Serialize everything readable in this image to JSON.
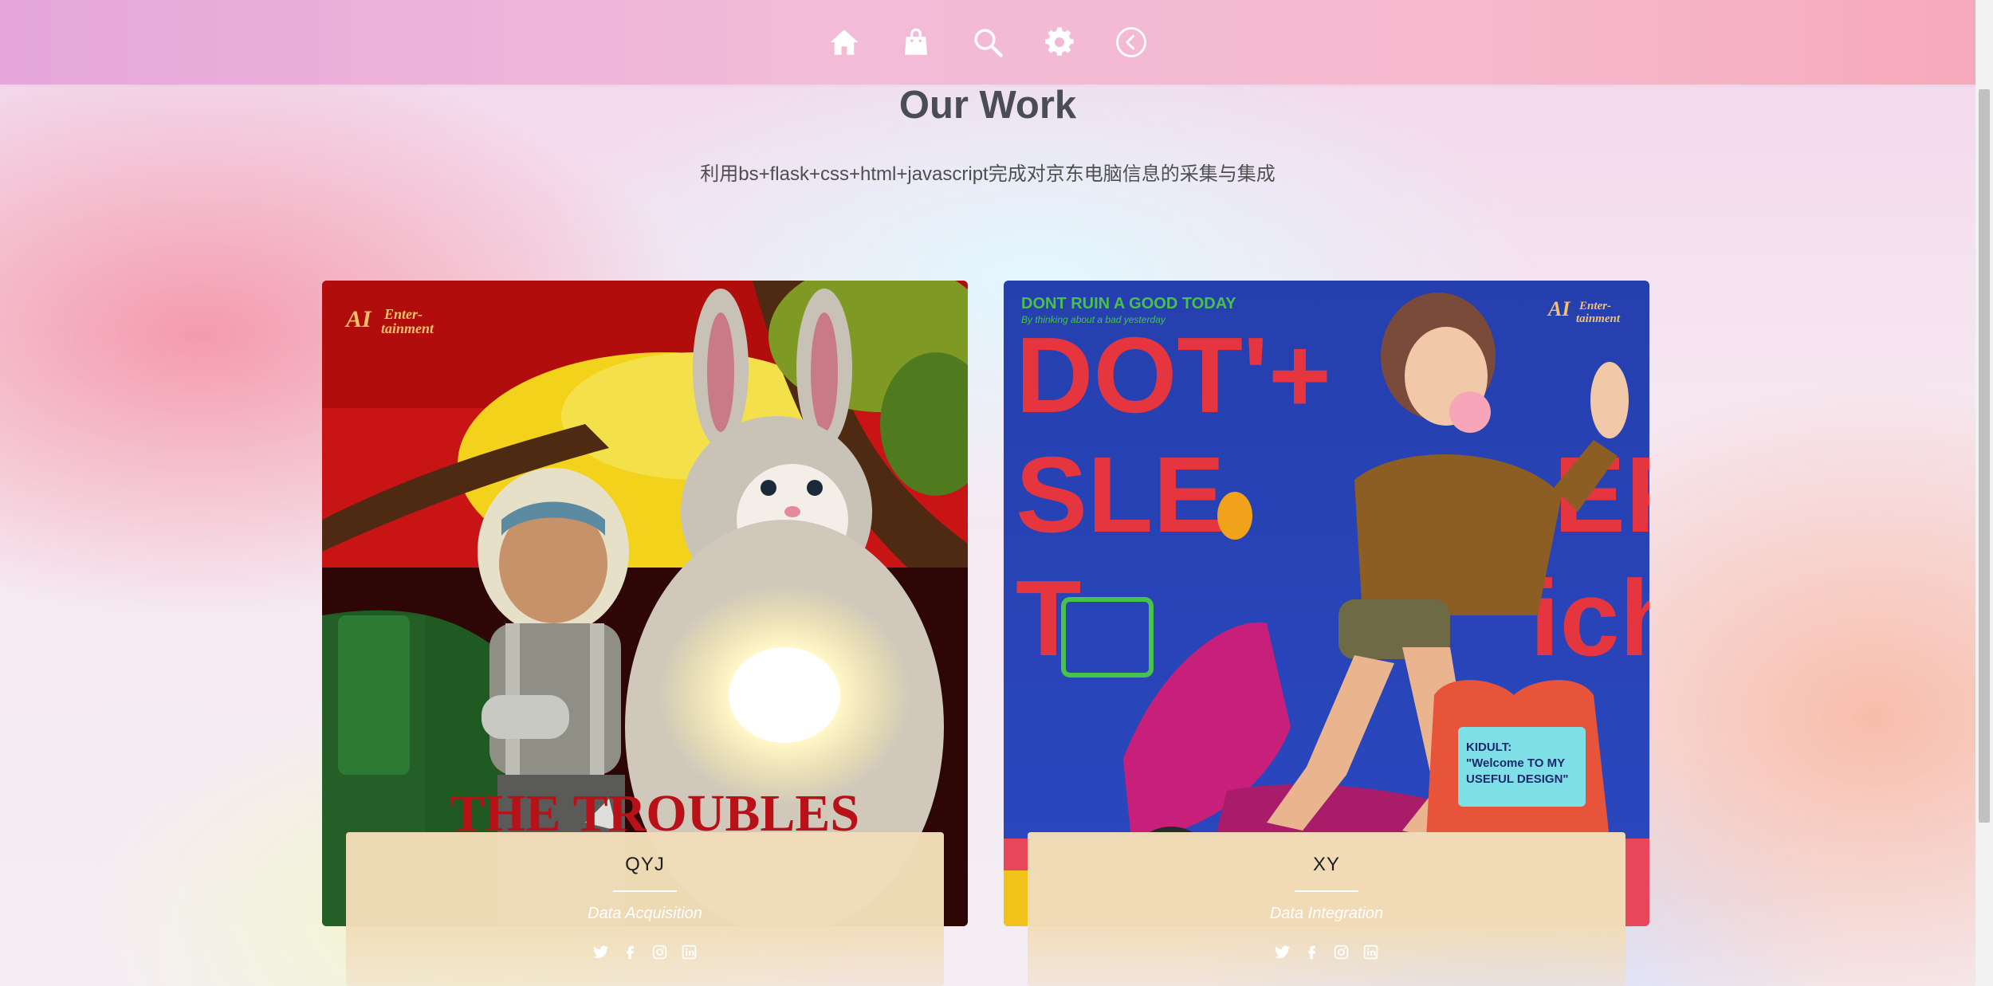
{
  "nav": {
    "items": [
      {
        "name": "home-icon"
      },
      {
        "name": "shopping-bag-icon"
      },
      {
        "name": "search-icon"
      },
      {
        "name": "gear-icon"
      },
      {
        "name": "back-circle-icon"
      }
    ]
  },
  "section": {
    "title": "Our Work",
    "subtitle": "利用bs+flask+css+html+javascript完成对京东电脑信息的采集与集成"
  },
  "team": [
    {
      "name": "QYJ",
      "role": "Data Acquisition",
      "image_text": "THE TROUBLES",
      "brand": "AI Enter-tainment"
    },
    {
      "name": "XY",
      "role": "Data Integration",
      "image_text": "DONT RUIN A GOOD TODAY",
      "brand": "AI Enter-tainment",
      "screen_text": "KIDULT: \"Welcome TO MY USEFUL DESIGN\""
    }
  ],
  "socials": [
    "twitter-icon",
    "facebook-icon",
    "instagram-icon",
    "linkedin-icon"
  ],
  "colors": {
    "nav_start": "#e6a6da",
    "nav_end": "#f7a9bb",
    "card_info": "#f1ddb8",
    "title": "#4a4d57"
  }
}
